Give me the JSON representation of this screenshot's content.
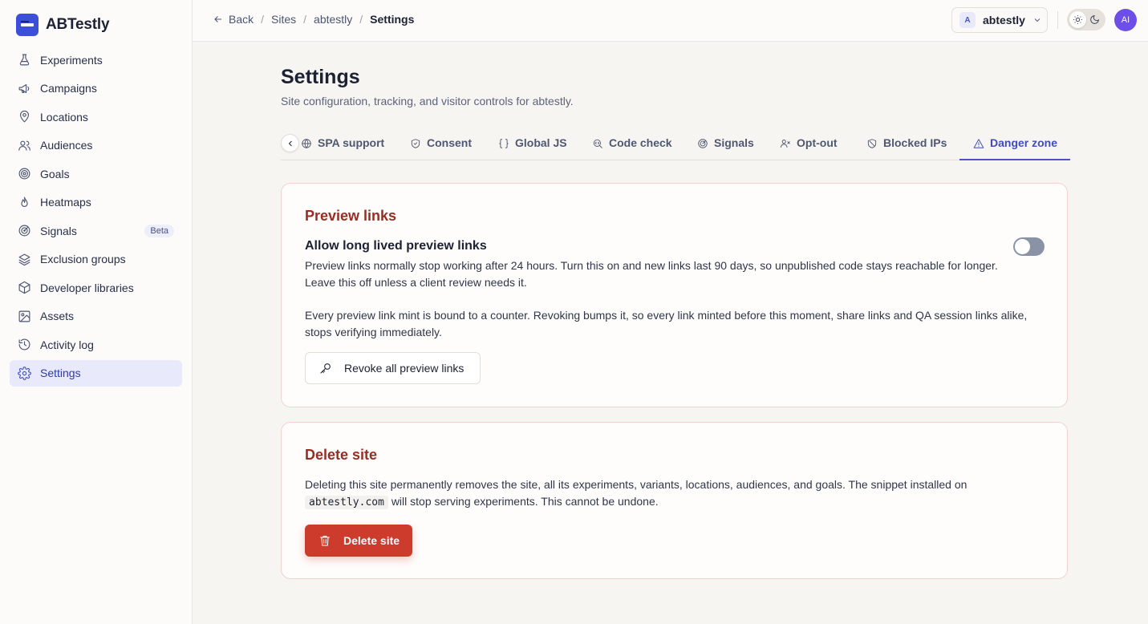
{
  "app": {
    "name": "ABTestly"
  },
  "sidebar": {
    "items": [
      {
        "label": "Experiments",
        "icon": "flask-icon",
        "active": false
      },
      {
        "label": "Campaigns",
        "icon": "megaphone-icon",
        "active": false
      },
      {
        "label": "Locations",
        "icon": "map-pin-icon",
        "active": false
      },
      {
        "label": "Audiences",
        "icon": "users-icon",
        "active": false
      },
      {
        "label": "Goals",
        "icon": "target-icon",
        "active": false
      },
      {
        "label": "Heatmaps",
        "icon": "flame-icon",
        "active": false
      },
      {
        "label": "Signals",
        "icon": "radar-icon",
        "active": false,
        "badge": "Beta"
      },
      {
        "label": "Exclusion groups",
        "icon": "layers-icon",
        "active": false
      },
      {
        "label": "Developer libraries",
        "icon": "package-icon",
        "active": false
      },
      {
        "label": "Assets",
        "icon": "image-icon",
        "active": false
      },
      {
        "label": "Activity log",
        "icon": "history-icon",
        "active": false
      },
      {
        "label": "Settings",
        "icon": "gear-icon",
        "active": true
      }
    ]
  },
  "header": {
    "back_label": "Back",
    "breadcrumb": [
      "Sites",
      "abtestly",
      "Settings"
    ],
    "site_switcher": {
      "initial": "A",
      "name": "abtestly"
    },
    "user_initials": "AI"
  },
  "page": {
    "title": "Settings",
    "subtitle": "Site configuration, tracking, and visitor controls for abtestly.",
    "tabs": [
      {
        "label": "SPA support",
        "icon": "globe-icon"
      },
      {
        "label": "Consent",
        "icon": "shield-check-icon"
      },
      {
        "label": "Global JS",
        "icon": "braces-icon"
      },
      {
        "label": "Code check",
        "icon": "search-code-icon"
      },
      {
        "label": "Signals",
        "icon": "radar-icon"
      },
      {
        "label": "Opt-out",
        "icon": "user-x-icon"
      },
      {
        "label": "Blocked IPs",
        "icon": "ban-shield-icon"
      },
      {
        "label": "Danger zone",
        "icon": "warning-triangle-icon",
        "active": true
      }
    ]
  },
  "preview_links": {
    "title": "Preview links",
    "setting_title": "Allow long lived preview links",
    "toggle_on": false,
    "description_1": "Preview links normally stop working after 24 hours. Turn this on and new links last 90 days, so unpublished code stays reachable for longer. Leave this off unless a client review needs it.",
    "description_2": "Every preview link mint is bound to a counter. Revoking bumps it, so every link minted before this moment, share links and QA session links alike, stops verifying immediately.",
    "revoke_button": "Revoke all preview links"
  },
  "delete_site": {
    "title": "Delete site",
    "description_before": "Deleting this site permanently removes the site, all its experiments, variants, locations, audiences, and goals. The snippet installed on",
    "domain": "abtestly.com",
    "description_after": "will stop serving experiments. This cannot be undone.",
    "button": "Delete site"
  },
  "colors": {
    "accent": "#4a55c2",
    "danger": "#cc3b2b",
    "danger_title": "#9b2c22",
    "brand": "#3b4fd8"
  }
}
